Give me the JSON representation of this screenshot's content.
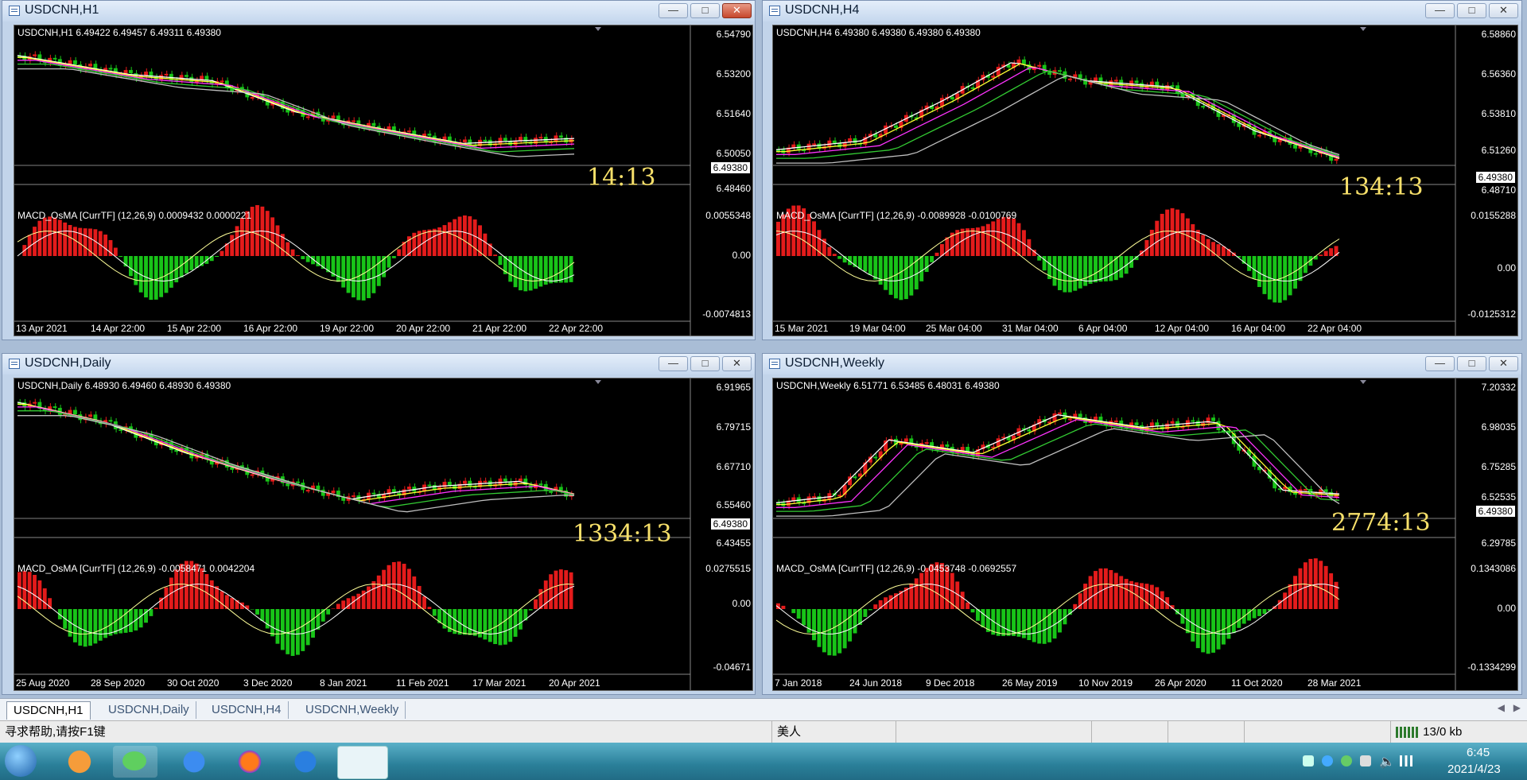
{
  "colors": {
    "bull": "#e41b1b",
    "bear": "#18c418",
    "ma_fast": "#ffffff",
    "ma_yellow": "#ffff33",
    "ma_magenta": "#ff33ff",
    "ma_green": "#33cc33",
    "ma_gray": "#bfbfbf",
    "timer": "#f7e06a"
  },
  "windows": [
    {
      "title": "USDCNH,H1",
      "header": "USDCNH,H1  6.49422 6.49457 6.49311 6.49380",
      "prices": [
        "6.54790",
        "6.53200",
        "6.51640",
        "6.50050",
        "6.48460"
      ],
      "current_price": "6.49380",
      "timer": "14:13",
      "macd_label": "MACD_OsMA [CurrTF] (12,26,9) 0.0009432 0.0000221",
      "macd_scale": [
        "0.0055348",
        "0.00",
        "-0.0074813"
      ],
      "dates": [
        "13 Apr 2021",
        "14 Apr 22:00",
        "15 Apr 22:00",
        "16 Apr 22:00",
        "19 Apr 22:00",
        "20 Apr 22:00",
        "21 Apr 22:00",
        "22 Apr 22:00"
      ]
    },
    {
      "title": "USDCNH,H4",
      "header": "USDCNH,H4  6.49380 6.49380 6.49380 6.49380",
      "prices": [
        "6.58860",
        "6.56360",
        "6.53810",
        "6.51260",
        "6.48710"
      ],
      "current_price": "6.49380",
      "timer": "134:13",
      "macd_label": "MACD_OsMA [CurrTF] (12,26,9) -0.0089928 -0.0100769",
      "macd_scale": [
        "0.0155288",
        "0.00",
        "-0.0125312"
      ],
      "dates": [
        "15 Mar 2021",
        "19 Mar 04:00",
        "25 Mar 04:00",
        "31 Mar 04:00",
        "6 Apr 04:00",
        "12 Apr 04:00",
        "16 Apr 04:00",
        "22 Apr 04:00"
      ]
    },
    {
      "title": "USDCNH,Daily",
      "header": "USDCNH,Daily  6.48930 6.49460 6.48930 6.49380",
      "prices": [
        "6.91965",
        "6.79715",
        "6.67710",
        "6.55460",
        "6.43455"
      ],
      "current_price": "6.49380",
      "timer": "1334:13",
      "macd_label": "MACD_OsMA [CurrTF] (12,26,9) -0.0058471 0.0042204",
      "macd_scale": [
        "0.0275515",
        "0.00",
        "-0.04671"
      ],
      "dates": [
        "25 Aug 2020",
        "28 Sep 2020",
        "30 Oct 2020",
        "3 Dec 2020",
        "8 Jan 2021",
        "11 Feb 2021",
        "17 Mar 2021",
        "20 Apr 2021"
      ]
    },
    {
      "title": "USDCNH,Weekly",
      "header": "USDCNH,Weekly  6.51771 6.53485 6.48031 6.49380",
      "prices": [
        "7.20332",
        "6.98035",
        "6.75285",
        "6.52535",
        "6.29785"
      ],
      "current_price": "6.49380",
      "timer": "2774:13",
      "macd_label": "MACD_OsMA [CurrTF] (12,26,9) -0.0453748 -0.0692557",
      "macd_scale": [
        "0.1343086",
        "0.00",
        "-0.1334299"
      ],
      "dates": [
        "7 Jan 2018",
        "24 Jun 2018",
        "9 Dec 2018",
        "26 May 2019",
        "10 Nov 2019",
        "26 Apr 2020",
        "11 Oct 2020",
        "28 Mar 2021"
      ]
    }
  ],
  "tabs": [
    "USDCNH,H1",
    "USDCNH,Daily",
    "USDCNH,H4",
    "USDCNH,Weekly"
  ],
  "status": {
    "help": "寻求帮助,请按F1键",
    "profile": "美人",
    "traffic": "13/0 kb"
  },
  "taskbar": {
    "time": "6:45",
    "date": "2021/4/23"
  }
}
